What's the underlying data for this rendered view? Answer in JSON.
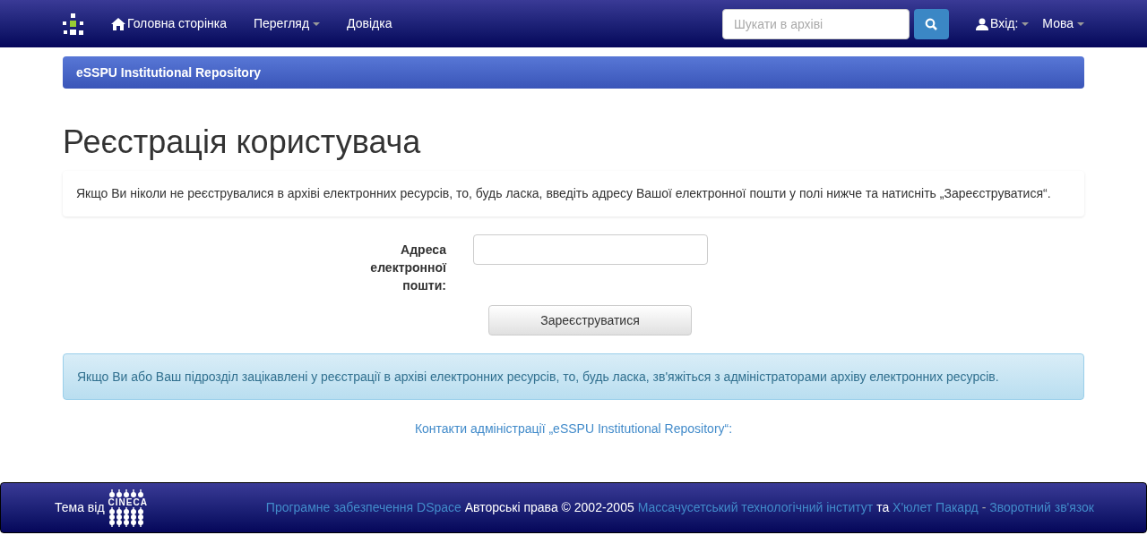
{
  "navbar": {
    "items": [
      {
        "label": "Головна сторінка",
        "kind": "home"
      },
      {
        "label": "Перегляд",
        "kind": "dropdown"
      },
      {
        "label": "Довідка",
        "kind": "plain"
      }
    ],
    "search": {
      "placeholder": "Шукати в архіві"
    },
    "login": "Вхід:",
    "language": "Мова"
  },
  "breadcrumb": "eSSPU Institutional Repository",
  "title": "Реєстрація користувача",
  "intro": "Якщо Ви ніколи не реєструвалися в архіві електронних ресурсів, то, будь ласка, введіть адресу Вашої електронної пошти у полі нижче та натисніть „Зареєструватися“.",
  "form": {
    "email_label": "Адреса електронної пошти:",
    "submit": "Зареєструватися"
  },
  "info": "Якщо Ви або Ваш підрозділ зацікавлені у реєстрації в архіві електронних ресурсів, то, будь ласка, зв'яжіться з адміністраторами архіву електронних ресурсів.",
  "contact_link": "Контакти адміністрації „eSSPU Institutional Repository“:",
  "footer": {
    "theme_by": "Тема від",
    "logo_text": "CINECA",
    "segments": [
      {
        "text": "Програмне забезпечення DSpace",
        "kind": "link"
      },
      {
        "text": "Авторські права © 2002-2005",
        "kind": "text"
      },
      {
        "text": "Массачусетський технологічний інститут",
        "kind": "link"
      },
      {
        "text": "та",
        "kind": "text"
      },
      {
        "text": "Х'юлет Пакард",
        "kind": "link"
      },
      {
        "text": "-",
        "kind": "sep"
      },
      {
        "text": "Зворотний зв'язок",
        "kind": "link"
      }
    ]
  }
}
